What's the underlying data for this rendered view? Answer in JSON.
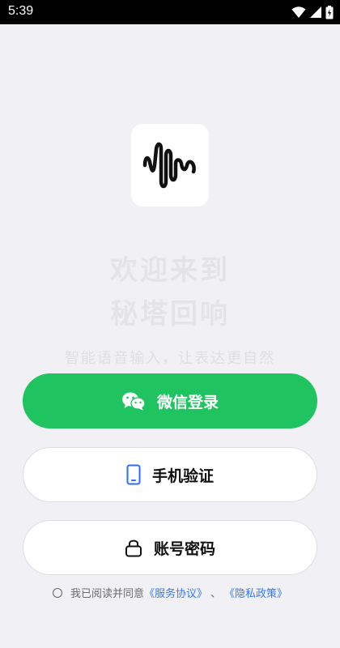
{
  "status_bar": {
    "time": "5:39"
  },
  "welcome": {
    "line1": "欢迎来到",
    "line2": "秘塔回响"
  },
  "tagline": "智能语音输入，让表达更自然",
  "buttons": {
    "wechat": "微信登录",
    "phone": "手机验证",
    "password": "账号密码"
  },
  "agreement": {
    "prefix": "我已阅读并同意",
    "service": "《服务协议》",
    "separator": "、",
    "privacy": "《隐私政策》"
  },
  "colors": {
    "wechat_green": "#1fc35f",
    "link_blue": "#3478f6",
    "phone_icon_blue": "#2f6bff"
  },
  "icons": [
    "wifi-icon",
    "signal-icon",
    "battery-icon",
    "app-logo-icon",
    "wechat-icon",
    "phone-icon",
    "lock-icon"
  ]
}
